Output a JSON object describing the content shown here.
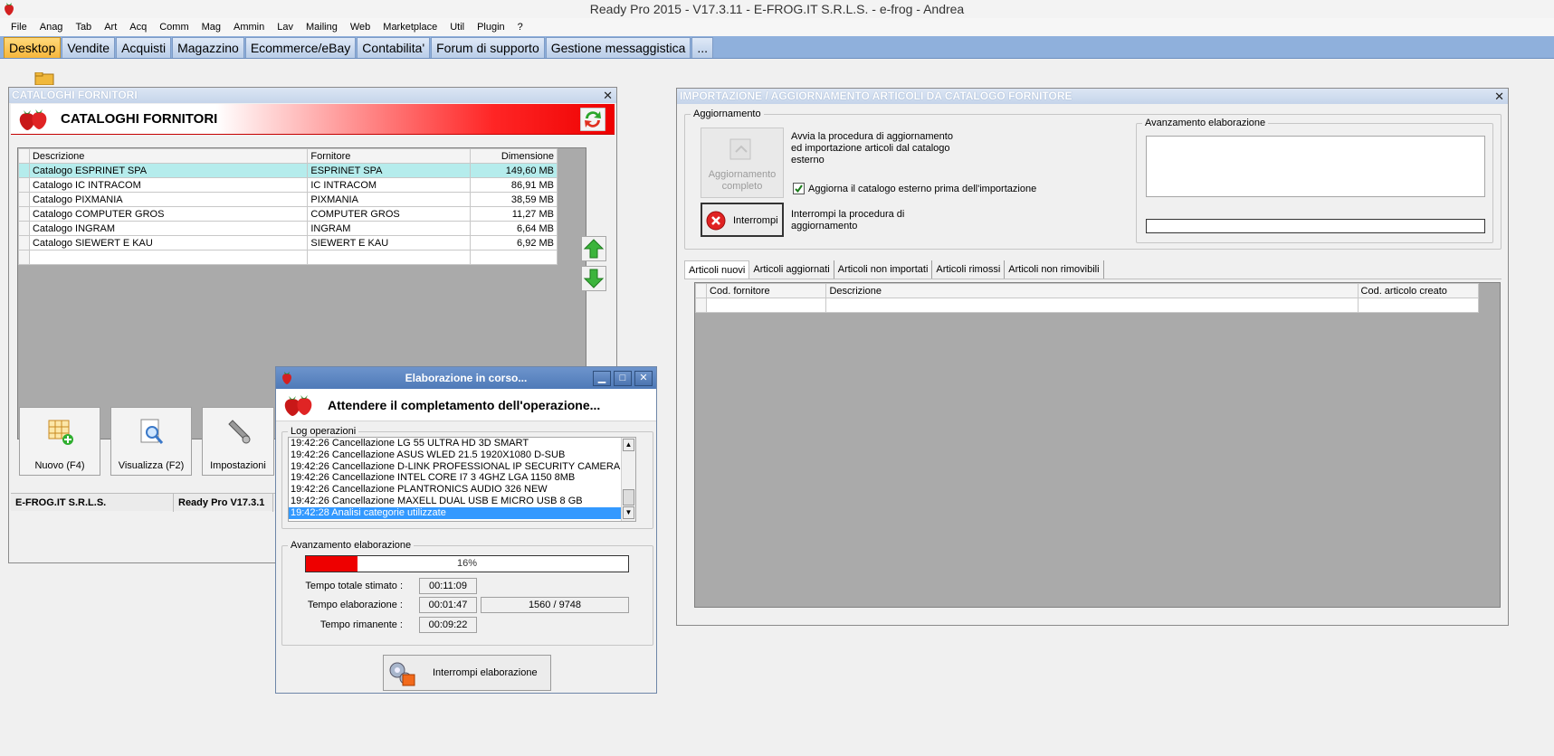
{
  "window": {
    "title": "Ready Pro 2015 - V17.3.11 - E-FROG.IT S.R.L.S. - e-frog - Andrea"
  },
  "menu": [
    "File",
    "Anag",
    "Tab",
    "Art",
    "Acq",
    "Comm",
    "Mag",
    "Ammin",
    "Lav",
    "Mailing",
    "Web",
    "Marketplace",
    "Util",
    "Plugin",
    "?"
  ],
  "tabs": [
    {
      "label": "Desktop",
      "active": true
    },
    {
      "label": "Vendite"
    },
    {
      "label": "Acquisti"
    },
    {
      "label": "Magazzino"
    },
    {
      "label": "Ecommerce/eBay"
    },
    {
      "label": "Contabilita'"
    },
    {
      "label": "Forum di supporto"
    },
    {
      "label": "Gestione messaggistica"
    },
    {
      "label": "..."
    }
  ],
  "cataloghi": {
    "caption": "CATALOGHI FORNITORI",
    "header_title": "CATALOGHI FORNITORI",
    "columns": [
      "Descrizione",
      "Fornitore",
      "Dimensione"
    ],
    "rows": [
      {
        "descrizione": "Catalogo ESPRINET SPA",
        "fornitore": "ESPRINET SPA",
        "dimensione": "149,60 MB",
        "selected": true
      },
      {
        "descrizione": "Catalogo IC INTRACOM",
        "fornitore": "IC INTRACOM",
        "dimensione": "86,91 MB"
      },
      {
        "descrizione": "Catalogo PIXMANIA",
        "fornitore": "PIXMANIA",
        "dimensione": "38,59 MB"
      },
      {
        "descrizione": "Catalogo COMPUTER GROS",
        "fornitore": "COMPUTER GROS",
        "dimensione": "11,27 MB"
      },
      {
        "descrizione": "Catalogo INGRAM",
        "fornitore": "INGRAM",
        "dimensione": "6,64 MB"
      },
      {
        "descrizione": "Catalogo SIEWERT E KAU",
        "fornitore": "SIEWERT E KAU",
        "dimensione": "6,92 MB"
      }
    ],
    "buttons": {
      "nuovo": "Nuovo (F4)",
      "visualizza": "Visualizza (F2)",
      "impostazioni": "Impostazioni"
    },
    "status": {
      "company": "E-FROG.IT S.R.L.S.",
      "version": "Ready Pro V17.3.1"
    }
  },
  "importazione": {
    "caption": "IMPORTAZIONE / AGGIORNAMENTO ARTICOLI DA CATALOGO FORNITORE",
    "group_aggiornamento": "Aggiornamento",
    "btn_aggiornamento": "Aggiornamento completo",
    "desc_aggiornamento": "Avvia la procedura di aggiornamento ed importazione articoli dal catalogo esterno",
    "checkbox_label": "Aggiorna il catalogo esterno prima dell'importazione",
    "btn_interrompi": "Interrompi",
    "desc_interrompi": "Interrompi la procedura di aggiornamento",
    "group_avanzamento": "Avanzamento elaborazione",
    "tabs": [
      "Articoli nuovi",
      "Articoli aggiornati",
      "Articoli non importati",
      "Articoli rimossi",
      "Articoli non rimovibili"
    ],
    "columns": [
      "Cod. fornitore",
      "Descrizione",
      "Cod. articolo creato"
    ]
  },
  "dialog": {
    "title": "Elaborazione in corso...",
    "message": "Attendere il completamento dell'operazione...",
    "group_log": "Log operazioni",
    "log": [
      "19:42:26 Cancellazione LG 55 ULTRA HD 3D SMART",
      "19:42:26 Cancellazione ASUS WLED 21.5 1920X1080 D-SUB",
      "19:42:26 Cancellazione D-LINK PROFESSIONAL IP SECURITY CAMERA",
      "19:42:26 Cancellazione INTEL CORE I7 3 4GHZ LGA 1150 8MB",
      "19:42:26 Cancellazione PLANTRONICS AUDIO 326 NEW",
      "19:42:26 Cancellazione MAXELL DUAL USB E MICRO USB 8 GB",
      "19:42:28 Analisi categorie utilizzate"
    ],
    "group_avanzamento": "Avanzamento elaborazione",
    "progress_percent": 16,
    "progress_label": "16%",
    "tempo_totale_label": "Tempo totale stimato :",
    "tempo_totale": "00:11:09",
    "tempo_elab_label": "Tempo elaborazione :",
    "tempo_elab": "00:01:47",
    "counter": "1560 / 9748",
    "tempo_rim_label": "Tempo rimanente :",
    "tempo_rim": "00:09:22",
    "btn_interrompi": "Interrompi elaborazione"
  },
  "colors": {
    "accent_red": "#ee0000",
    "tab_bar": "#8fb0dc",
    "selected_row": "#b5ecec"
  }
}
